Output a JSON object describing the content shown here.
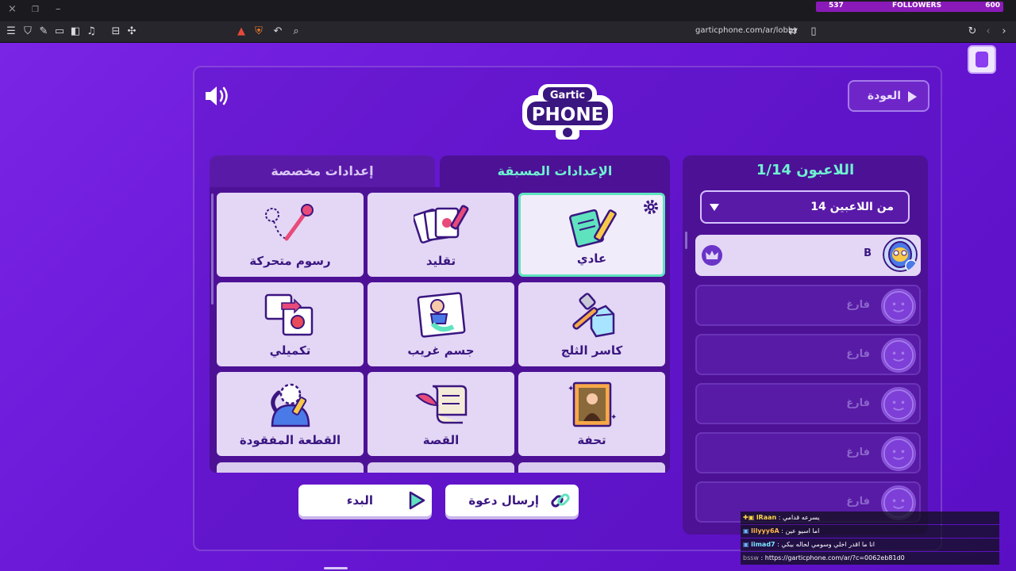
{
  "window": {
    "close_icon": "×",
    "restore_icon": "❐",
    "minimize_icon": "–"
  },
  "stream_overlay": {
    "followers_label": "FOLLOWERS",
    "followers_current": "537",
    "followers_goal": "600"
  },
  "browser": {
    "url": "garticphone.com/ar/lobby"
  },
  "header": {
    "back_label": "العودة",
    "logo_top": "Gartic",
    "logo_bottom": "PHONE"
  },
  "tabs": {
    "custom": "إعدادات مخصصة",
    "preset": "الإعدادات المسبقة"
  },
  "modes": [
    {
      "title": "عادي",
      "icon": "notepad-pencil-icon",
      "selected": true
    },
    {
      "title": "تقليد",
      "icon": "cards-pencil-icon"
    },
    {
      "title": "رسوم متحركة",
      "icon": "animation-path-icon"
    },
    {
      "title": "كاسر الثلج",
      "icon": "hammer-ice-icon"
    },
    {
      "title": "جسم غريب",
      "icon": "weird-body-icon"
    },
    {
      "title": "تكميلي",
      "icon": "puzzle-apple-icon"
    },
    {
      "title": "تحفة",
      "icon": "mona-lisa-frame-icon"
    },
    {
      "title": "القصة",
      "icon": "scroll-quill-icon"
    },
    {
      "title": "القطعة المفقودة",
      "icon": "missing-piece-icon"
    }
  ],
  "actions": {
    "start": "البدء",
    "invite": "إرسال دعوة"
  },
  "players": {
    "title": "اللاعبون 1/14",
    "max_select": "14 من اللاعبين",
    "slots": [
      {
        "name": "B",
        "filled": true
      },
      {
        "name": "فارغ"
      },
      {
        "name": "فارغ"
      },
      {
        "name": "فارغ"
      },
      {
        "name": "فارغ"
      },
      {
        "name": "فارغ"
      }
    ]
  },
  "chat": [
    {
      "user": "lRaan",
      "text": "يسرعه قدامي"
    },
    {
      "user": "lilyyy6A",
      "text": "اما اسيو عين"
    },
    {
      "user": "iimad7",
      "text": "انا ما اقدر اخلي وسومي لحاله بيكي"
    },
    {
      "user": "bssw",
      "text": "https://garticphone.com/ar/?c=0062eb81d0"
    }
  ],
  "colors": {
    "background": "#6a1bd8",
    "panel": "#4d1196",
    "accent": "#6ff1d0",
    "card": "#e3d7f5",
    "text_dark": "#3a1680"
  }
}
